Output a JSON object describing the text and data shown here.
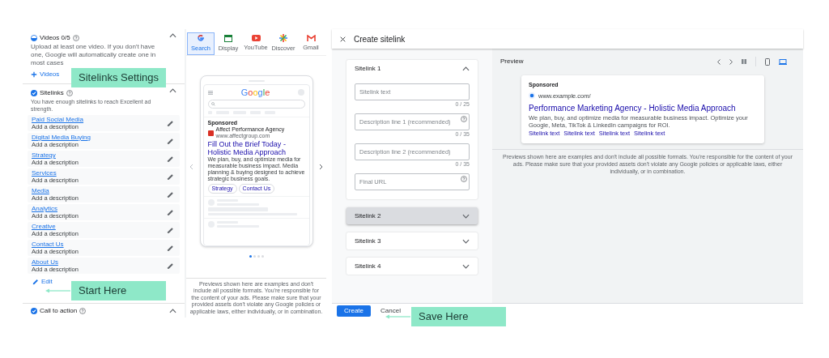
{
  "annotations": [
    {
      "kind": "label",
      "text": "Sitelinks Settings"
    },
    {
      "kind": "arrow",
      "text": "Start Here"
    },
    {
      "kind": "arrow",
      "text": "Save Here"
    }
  ],
  "asset_panel": {
    "videos": {
      "title": "Videos 0/5",
      "description": "Upload at least one video. If you don't have one, Google will automatically create one in most cases",
      "add_label": "Videos",
      "expanded": true
    },
    "sitelinks": {
      "title": "Sitelinks",
      "description": "You have enough sitelinks to reach Excellent ad strength.",
      "expanded": true,
      "edit_label": "Edit",
      "items": [
        {
          "title": "Paid Social Media",
          "description": "Add a description"
        },
        {
          "title": "Digital Media Buying",
          "description": "Add a description"
        },
        {
          "title": "Strategy",
          "description": "Add a description"
        },
        {
          "title": "Services",
          "description": "Add a description"
        },
        {
          "title": "Media",
          "description": "Add a description"
        },
        {
          "title": "Analytics",
          "description": "Add a description"
        },
        {
          "title": "Creative",
          "description": "Add a description"
        },
        {
          "title": "Contact Us",
          "description": "Add a description"
        },
        {
          "title": "About Us",
          "description": "Add a description"
        }
      ]
    },
    "call_to_action": {
      "title": "Call to action",
      "expanded": true
    }
  },
  "ad_preview": {
    "tabs": [
      {
        "kind": "search",
        "label": "Search",
        "selected": true
      },
      {
        "kind": "display",
        "label": "Display",
        "selected": false
      },
      {
        "kind": "youtube",
        "label": "YouTube",
        "selected": false
      },
      {
        "kind": "discover",
        "label": "Discover",
        "selected": false
      },
      {
        "kind": "gmail",
        "label": "Gmail",
        "selected": false
      }
    ],
    "logo": "Google",
    "ad": {
      "sponsored": "Sponsored",
      "advertiser": "Affect Performance Agency",
      "url": "www.affectgroup.com",
      "headline": "Fill Out the Brief Today - Holistic Media Approach",
      "body": "We plan, buy, and optimize media for measurable business impact. Media planning & buying designed to achieve strategic business goals.",
      "sitelinks": [
        "Strategy",
        "Contact Us"
      ]
    },
    "pages": [
      {
        "selected": true
      },
      {
        "selected": false
      },
      {
        "selected": false
      },
      {
        "selected": false
      }
    ],
    "disclaimer": "Previews shown here are examples and don't include all possible formats. You're responsible for the content of your ads. Please make sure that your provided assets don't violate any Google policies or applicable laws, either individually, or in combination."
  },
  "create_sitelink": {
    "title": "Create sitelink",
    "sitelinks": [
      {
        "title": "Sitelink 1",
        "expanded": true,
        "highlighted": false,
        "fields": [
          {
            "placeholder": "Sitelink text",
            "counter": "0 / 25",
            "help": false
          },
          {
            "placeholder": "Description line 1 (recommended)",
            "counter": "0 / 35",
            "help": true
          },
          {
            "placeholder": "Description line 2 (recommended)",
            "counter": "0 / 35",
            "help": false
          },
          {
            "placeholder": "Final URL",
            "help": true
          }
        ]
      },
      {
        "title": "Sitelink 2",
        "expanded": false,
        "highlighted": true
      },
      {
        "title": "Sitelink 3",
        "expanded": false,
        "highlighted": false
      },
      {
        "title": "Sitelink 4",
        "expanded": false,
        "highlighted": false
      }
    ],
    "buttons": [
      {
        "kind": "primary",
        "label": "Create"
      },
      {
        "kind": "text",
        "label": "Cancel"
      }
    ],
    "preview": {
      "title": "Preview",
      "devices": [
        {
          "kind": "mobile",
          "selected": false
        },
        {
          "kind": "desktop",
          "selected": true
        }
      ],
      "ad": {
        "sponsored": "Sponsored",
        "url": "www.example.com/",
        "headline": "Performance Marketing Agency - Holistic Media Approach",
        "body": "We plan, buy, and optimize media for measurable business impact. Optimize your Google, Meta, TikTok & LinkedIn campaigns for ROI.",
        "sitelinks": [
          "Sitelink text",
          "Sitelink text",
          "Sitelink text",
          "Sitelink text"
        ]
      },
      "disclaimer": "Previews shown here are examples and don't include all possible formats. You're responsible for the content of your ads. Please make sure that your provided assets don't violate any Google policies or applicable laws, either individually, or in combination."
    }
  }
}
